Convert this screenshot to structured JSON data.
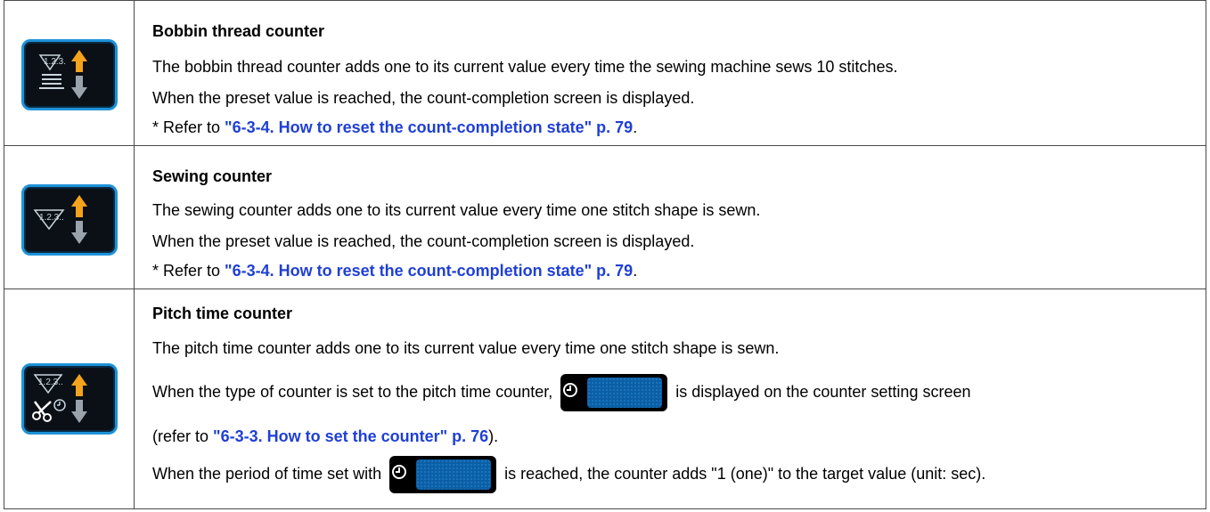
{
  "rows": [
    {
      "icon": "bobbin-thread-counter-icon",
      "title": "Bobbin thread counter",
      "line1": "The bobbin thread counter adds one to its current value every time the sewing machine sews 10 stitches.",
      "line2": "When the preset value is reached, the count-completion screen is displayed.",
      "ref_prefix": "* Refer to ",
      "ref_link": "\"6-3-4. How to reset the count-completion state\" p. 79",
      "ref_suffix": "."
    },
    {
      "icon": "sewing-counter-icon",
      "title": "Sewing counter",
      "line1": "The sewing counter adds one to its current value every time one stitch shape is sewn.",
      "line2": "When the preset value is reached, the count-completion screen is displayed.",
      "ref_prefix": "* Refer to ",
      "ref_link": "\"6-3-4. How to reset the count-completion state\" p. 79",
      "ref_suffix": "."
    },
    {
      "icon": "pitch-time-counter-icon",
      "title": "Pitch time counter",
      "line1": "The pitch time counter adds one to its current value every time one stitch shape is sewn.",
      "line2a": "When the type of counter is set to the pitch time counter,",
      "line2b": "is displayed on the counter setting screen",
      "line3_prefix": "(refer to ",
      "line3_link": "\"6-3-3. How to set the counter\" p. 76",
      "line3_suffix": ").",
      "line4a": "When the period of time set with",
      "line4b": "is reached, the counter adds \"1 (one)\" to the target value (unit: sec)."
    }
  ],
  "icon_labels": {
    "bobbin": "1.2.3.",
    "sewing": "1.2.3..",
    "pitch": "1.2.3.."
  },
  "colors": {
    "button_border": "#1e92d8",
    "arrow_up": "#f5a21c",
    "arrow_down": "#9aa3ab",
    "link": "#1f3fd6"
  }
}
